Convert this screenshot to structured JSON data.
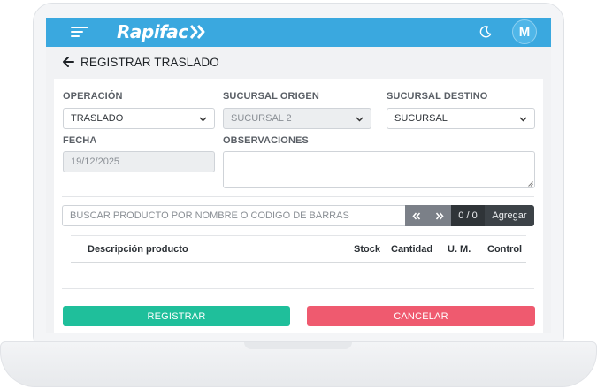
{
  "colors": {
    "topbar": "#3aa8df",
    "register": "#1fbf9b",
    "cancel": "#ef5a6f",
    "counter_bg": "#2f3438",
    "pager_bg": "#7b8088"
  },
  "header": {
    "brand": "Rapifac",
    "menu_icon": "hamburger-icon",
    "theme_icon": "moon-icon",
    "avatar_initial": "M"
  },
  "page": {
    "back_icon": "arrow-left-icon",
    "title": "REGISTRAR TRASLADO"
  },
  "form": {
    "operacion": {
      "label": "OPERACIÓN",
      "value": "TRASLADO"
    },
    "sucursal_origen": {
      "label": "SUCURSAL ORIGEN",
      "value": "SUCURSAL 2"
    },
    "sucursal_destino": {
      "label": "SUCURSAL DESTINO",
      "value": "SUCURSAL"
    },
    "fecha": {
      "label": "FECHA",
      "value": "19/12/2025"
    },
    "observaciones": {
      "label": "OBSERVACIONES",
      "value": ""
    }
  },
  "search": {
    "placeholder": "BUSCAR PRODUCTO POR NOMBRE O CODIGO DE BARRAS",
    "counter": "0 / 0",
    "add_label": "Agregar"
  },
  "table": {
    "columns": [
      "Descripción producto",
      "Stock",
      "Cantidad",
      "U. M.",
      "Control"
    ]
  },
  "actions": {
    "register": "REGISTRAR",
    "cancel": "CANCELAR"
  }
}
